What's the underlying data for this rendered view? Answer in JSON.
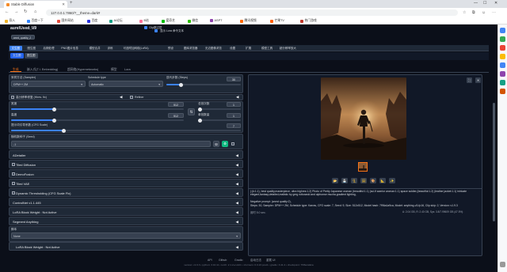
{
  "browser": {
    "tab_title": "Stable Diffusion",
    "url": "127.0.0.1:7860/?__theme=dark#",
    "bookmarks": [
      {
        "label": "导入",
        "color": "#f0b429"
      },
      {
        "label": "百度一下",
        "color": "#3385ff"
      },
      {
        "label": "国外网站",
        "color": "#e74c3c"
      },
      {
        "label": "百度",
        "color": "#2932e1"
      },
      {
        "label": "AI论坛",
        "color": "#16a085"
      },
      {
        "label": "B站",
        "color": "#fb7299"
      },
      {
        "label": "爱奇艺",
        "color": "#00be06"
      },
      {
        "label": "微信",
        "color": "#2dc100"
      },
      {
        "label": "ASPT",
        "color": "#8e44ad"
      },
      {
        "label": "腾讯视频",
        "color": "#ff6a00"
      },
      {
        "label": "芒果TV",
        "color": "#ff5f00"
      },
      {
        "label": "热门游戏",
        "color": "#c0392b"
      }
    ]
  },
  "header": {
    "checkpoint_label": "Stable Diffusion checkpoint",
    "vae_label": "SD VAE",
    "checkpoint_value": "aurelUsed_V9",
    "clip_label": "Clip跳过层",
    "toggle_label": "显示 Lora 命令文本",
    "lora_value": "2",
    "sub_tag": "word_quality_2"
  },
  "nav_tabs": [
    "文生图",
    "图生图",
    "后期处理",
    "PNG图片信息",
    "模型合并",
    "训练",
    "可选附加网络(LoRA)",
    "预设",
    "图库浏览器",
    "无边图像浏览",
    "设置",
    "扩展",
    "模型工具",
    "超分辨率放大"
  ],
  "sub_tabs": [
    "文生图",
    "图生图"
  ],
  "main_tabs": [
    "生成",
    "嵌入式(T.I. Embedding)",
    "超网络(Hypernetworks)",
    "模型",
    "Lora"
  ],
  "params": {
    "sampler_label": "采样方法 (Sampler)",
    "sampler_value": "DPM++ 2M",
    "schedule_label": "Schedule type",
    "schedule_value": "Automatic",
    "steps_label": "迭代步数 (Steps)",
    "steps_value": "30",
    "hires_label": "高分辨率修复 (Hires. fix)",
    "refiner_label": "Refiner",
    "width_label": "宽度",
    "width_value": "512",
    "batch_count_label": "总批次数",
    "batch_count_value": "1",
    "height_label": "高度",
    "height_value": "512",
    "batch_size_label": "单批数量",
    "batch_size_value": "1",
    "cfg_label": "提示词引导系数 (CFG Scale)",
    "cfg_value": "7",
    "seed_label": "随机数种子 (Seed)",
    "seed_value": "-1",
    "steps_level": 0.2,
    "width_level": 0.25,
    "height_level": 0.25,
    "cfg_level": 0.23
  },
  "accordions": [
    {
      "label": "ADetailer",
      "checkbox": false
    },
    {
      "label": "Tiled Diffusion",
      "checkbox": true
    },
    {
      "label": "DemoFusion",
      "checkbox": true
    },
    {
      "label": "Tiled VAE",
      "checkbox": true
    },
    {
      "label": "Dynamic Thresholding (CFG Scale Fix)",
      "checkbox": true
    },
    {
      "label": "ControlNet v1.1.445",
      "checkbox": false
    },
    {
      "label": "LoRA Block Weight : Not Active",
      "checkbox": false
    },
    {
      "label": "Segment Anything",
      "checkbox": false
    }
  ],
  "script": {
    "label": "脚本",
    "value": "None",
    "last_accordion": "LoRA Block Weight : Not Active"
  },
  "output": {
    "info_text": "(:(k:1.1), best quality,masterpiece, ultra highres:1.2) Photo of Pretty Japanese woman (beautiful:1.1) (sci-fi warrior woman:1.1) space soldier,(beautiful:1.2) (leather jacket:1.1) intricate elegant,fantasy,detailed,realistic by greg rutkowski and alphonse mucha,gradient lighting,",
    "negative_text": "Negative prompt: (worst quality:2),",
    "meta_text": "Steps: 30, Sampler: DPM++ 2M, Schedule type: Karras, CFG scale: 7, Seed: 9, Size: 512x512, Model hash: 7f96a1a9ca, Model: anything-v3-fp16, Clip skip: 2, Version: v1.9.3",
    "time_text": "用时 5.0 sec.",
    "vram_text": "A: 2.04 GB, R: 2.40 GB, Sys: 3.8/7.99609 GB (47.5%)",
    "tool_icons": [
      "📂",
      "💾",
      "🗜",
      "🖼",
      "🎨",
      "📐",
      "✨"
    ]
  },
  "footer": {
    "links": [
      "API",
      "Github",
      "Gradio",
      "启动日志",
      "重载 UI"
    ],
    "versions": "version: v1.9.3  •  python: 3.10.11  •  torch: 2.1.2+cu121  •  xformers: 0.0.23.post1  •  gradio: 3.41.2  •  checkpoint: 7f96a1a9ca"
  }
}
